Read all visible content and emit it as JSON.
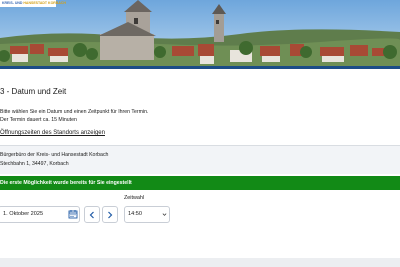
{
  "header": {
    "logo_line1": "KREIS- UND",
    "logo_line2": "HANSESTADT KORBACH"
  },
  "step": {
    "title": "3 - Datum und Zeit",
    "intro_line1": "Bitte wählen Sie ein Datum und einen Zeitpunkt für Ihren Termin.",
    "intro_line2": "Der Termin dauert ca. 15 Minuten",
    "hours_link": "Öffnungszeiten des Standorts anzeigen"
  },
  "location": {
    "name": "Bürgerbüro der Kreis- und Hansestadt Korbach",
    "address": "Stechbahn 1, 34497, Korbach"
  },
  "alert": {
    "text": "Die erste Möglichkeit wurde bereits für Sie eingestellt"
  },
  "form": {
    "date_value": "1. Oktober 2025",
    "time_label": "Zeitwahl",
    "time_value": "14:50"
  },
  "icons": {
    "calendar": "calendar-icon",
    "prev": "chevron-left-icon",
    "next": "chevron-right-icon",
    "select": "chevron-down-icon"
  },
  "colors": {
    "brand_blue": "#1c4d87",
    "alert_green": "#128a16",
    "link_blue": "#1f5aa6"
  }
}
